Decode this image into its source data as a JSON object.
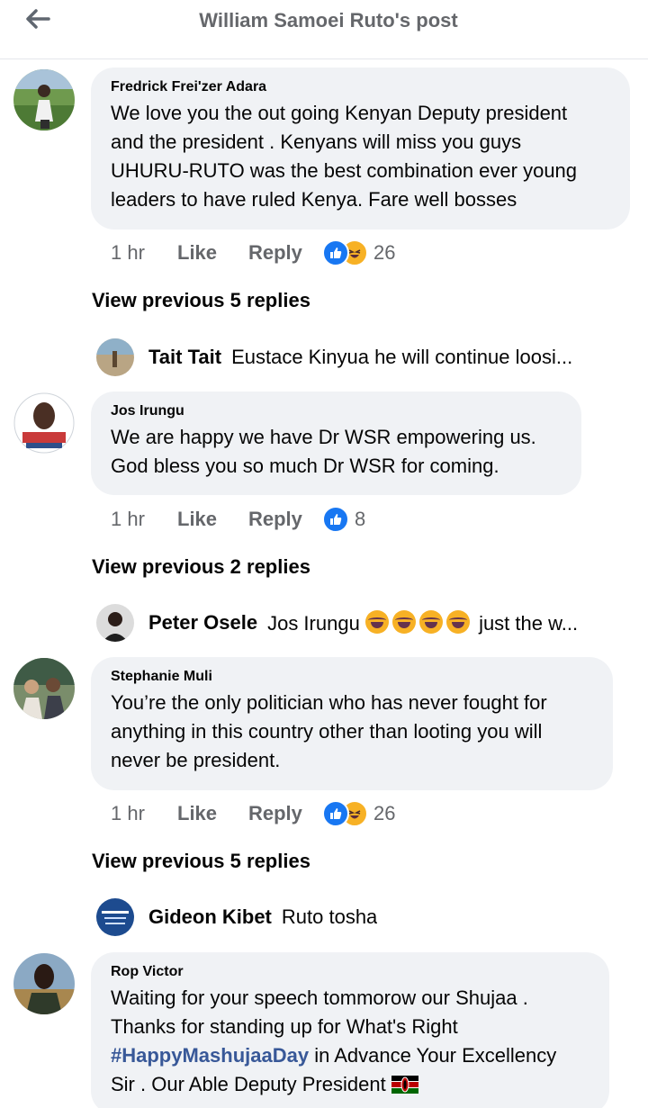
{
  "header": {
    "title": "William Samoei Ruto's post"
  },
  "comments": [
    {
      "author": "Fredrick Frei'zer Adara",
      "lines": [
        "We love you the out going Kenyan Deputy president",
        "and the president . Kenyans will miss you guys",
        "UHURU-RUTO was the best combination ever young",
        "leaders to have ruled Kenya.  Fare well bosses"
      ],
      "time": "1 hr",
      "like": "Like",
      "reply": "Reply",
      "reaction_count": "26",
      "view_previous": "View previous 5 replies",
      "latest_reply": {
        "name": "Tait Tait",
        "text": "Eustace Kinyua he will continue loosi..."
      }
    },
    {
      "author": "Jos Irungu",
      "lines": [
        "We are happy we have Dr WSR empowering us.",
        "God bless you so much Dr WSR for coming."
      ],
      "time": "1 hr",
      "like": "Like",
      "reply": "Reply",
      "reaction_count": "8",
      "view_previous": "View previous 2 replies",
      "latest_reply": {
        "name": "Peter Osele",
        "text_before": "Jos Irungu",
        "text_after": "just the w..."
      }
    },
    {
      "author": "Stephanie Muli",
      "lines": [
        "You’re the only politician who has never fought for",
        "anything in this country other than looting you will",
        "never be president."
      ],
      "time": "1 hr",
      "like": "Like",
      "reply": "Reply",
      "reaction_count": "26",
      "view_previous": "View previous 5 replies",
      "latest_reply": {
        "name": "Gideon Kibet",
        "text": "Ruto tosha"
      }
    },
    {
      "author": "Rop Victor",
      "lines": [
        "Waiting for your speech tommorow our Shujaa .",
        "Thanks for standing up for What's Right"
      ],
      "hashtag": "#HappyMashujaaDay",
      "line3_rest": " in Advance Your Excellency",
      "line4": "Sir . Our Able Deputy President"
    }
  ],
  "colors": {
    "bubble": "#f0f2f5",
    "secondary_text": "#65676b",
    "like_blue": "#1877f2",
    "haha_yellow": "#f7b125",
    "hashtag": "#385898"
  },
  "icons": [
    "back-arrow-icon",
    "like-reaction-icon",
    "haha-reaction-icon",
    "laughing-tears-emoji",
    "kenya-flag-emoji"
  ]
}
